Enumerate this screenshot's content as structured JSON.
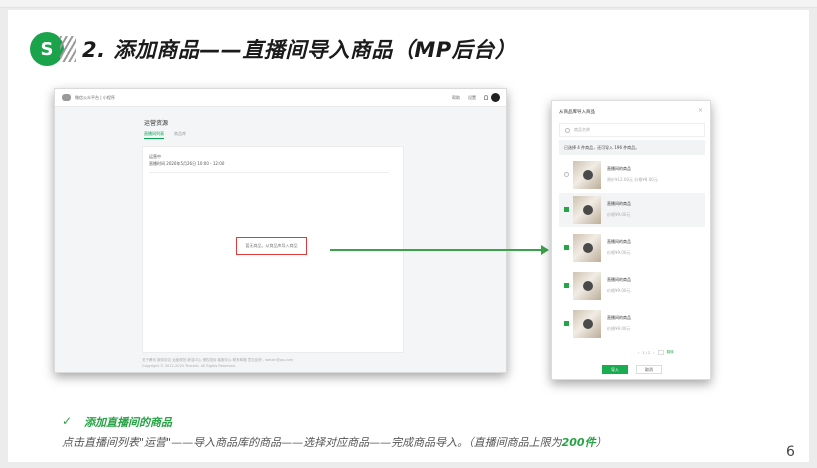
{
  "header": {
    "title": "2. 添加商品——直播间导入商品（MP后台）",
    "logo_glyph": "S"
  },
  "screenshot": {
    "brand": "微信公众平台 | 小程序",
    "nav": [
      "帮助",
      "设置"
    ],
    "page_title": "运营资源",
    "tabs": [
      "直播间列表",
      "商品库"
    ],
    "room_label": "运营中",
    "room_line": "直播时间  2020年5月26日 10:00 - 12:00",
    "highlight_text": "暂无商品，从商品库导入商品",
    "footer_links": "关于腾讯   服务协议   运营规范   辟谣中心   侵权投诉   客服中心   联系邮箱   意见反馈 - weixin@qq.com",
    "footer_copy": "Copyright © 2012-2020 Tencent. All Rights Reserved."
  },
  "dialog": {
    "title": "从商品库导入商品",
    "search_placeholder": "商品名称",
    "info": "已选择 4 件商品，还可导入 196 件商品。",
    "items": [
      {
        "name": "直播间的商品",
        "price": "原价¥12.00元 价格¥8.00元",
        "checked": false,
        "selected": false
      },
      {
        "name": "直播间的商品",
        "price": "价格¥9.00元",
        "checked": true,
        "selected": true
      },
      {
        "name": "直播间的商品",
        "price": "价格¥9.00元",
        "checked": true,
        "selected": false
      },
      {
        "name": "直播间的商品",
        "price": "价格¥9.00元",
        "checked": true,
        "selected": false
      },
      {
        "name": "直播间的商品",
        "price": "价格¥9.00元",
        "checked": true,
        "selected": false
      }
    ],
    "pager": "1 / 2",
    "pager_go": "跳转",
    "ok": "导入",
    "cancel": "取消"
  },
  "footer": {
    "check": "✓",
    "subtitle": "添加直播间的商品",
    "desc_main": "点击直播间列表\"运营\"——导入商品库的商品——选择对应商品——完成商品导入。（直播间商品上限为",
    "desc_limit": "200件",
    "desc_end": "）",
    "page_number": "6"
  },
  "colors": {
    "accent": "#27a345",
    "highlight": "#e03a3a"
  }
}
